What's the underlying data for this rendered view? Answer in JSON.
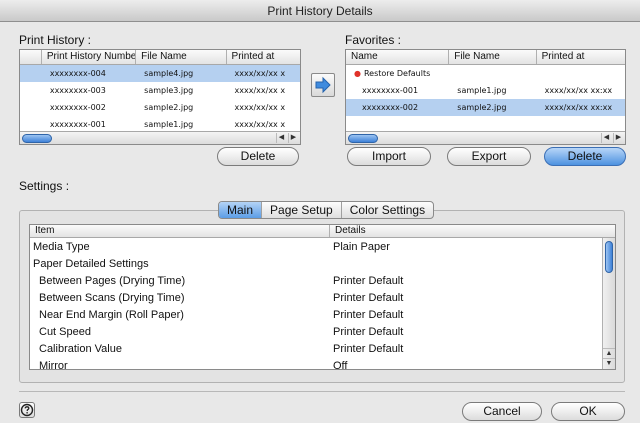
{
  "window": {
    "title": "Print History Details"
  },
  "print_history": {
    "label": "Print History :",
    "columns": [
      "Print History Number",
      "File Name",
      "Printed at"
    ],
    "rows": [
      {
        "number": "xxxxxxxx-004",
        "file": "sample4.jpg",
        "printed": "xxxx/xx/xx x",
        "selected": true
      },
      {
        "number": "xxxxxxxx-003",
        "file": "sample3.jpg",
        "printed": "xxxx/xx/xx x",
        "selected": false
      },
      {
        "number": "xxxxxxxx-002",
        "file": "sample2.jpg",
        "printed": "xxxx/xx/xx x",
        "selected": false
      },
      {
        "number": "xxxxxxxx-001",
        "file": "sample1.jpg",
        "printed": "xxxx/xx/xx x",
        "selected": false
      }
    ],
    "delete_label": "Delete"
  },
  "favorites": {
    "label": "Favorites :",
    "columns": [
      "Name",
      "File Name",
      "Printed at"
    ],
    "rows": [
      {
        "name": "Restore Defaults",
        "file": "",
        "printed": "",
        "selected": false,
        "bullet": true
      },
      {
        "name": "xxxxxxxx-001",
        "file": "sample1.jpg",
        "printed": "xxxx/xx/xx xx:xx",
        "selected": false,
        "bullet": false
      },
      {
        "name": "xxxxxxxx-002",
        "file": "sample2.jpg",
        "printed": "xxxx/xx/xx xx:xx",
        "selected": true,
        "bullet": false
      }
    ],
    "import_label": "Import",
    "export_label": "Export",
    "delete_label": "Delete"
  },
  "settings": {
    "label": "Settings :",
    "tabs": [
      {
        "label": "Main",
        "active": true
      },
      {
        "label": "Page Setup",
        "active": false
      },
      {
        "label": "Color Settings",
        "active": false
      }
    ],
    "columns": [
      "Item",
      "Details"
    ],
    "rows": [
      {
        "item": "Media Type",
        "details": "Plain Paper",
        "indent": false
      },
      {
        "item": "Paper Detailed Settings",
        "details": "",
        "indent": false
      },
      {
        "item": "Between Pages (Drying Time)",
        "details": "Printer Default",
        "indent": true
      },
      {
        "item": "Between Scans (Drying Time)",
        "details": "Printer Default",
        "indent": true
      },
      {
        "item": "Near End Margin (Roll Paper)",
        "details": "Printer Default",
        "indent": true
      },
      {
        "item": "Cut Speed",
        "details": "Printer Default",
        "indent": true
      },
      {
        "item": "Calibration Value",
        "details": "Printer Default",
        "indent": true
      },
      {
        "item": "Mirror",
        "details": "Off",
        "indent": true
      }
    ]
  },
  "footer": {
    "help_icon": "question-mark-icon",
    "cancel_label": "Cancel",
    "ok_label": "OK"
  },
  "colors": {
    "selection": "#b5d0f0",
    "accent": "#4d92e0",
    "bullet": "#e0322a"
  }
}
